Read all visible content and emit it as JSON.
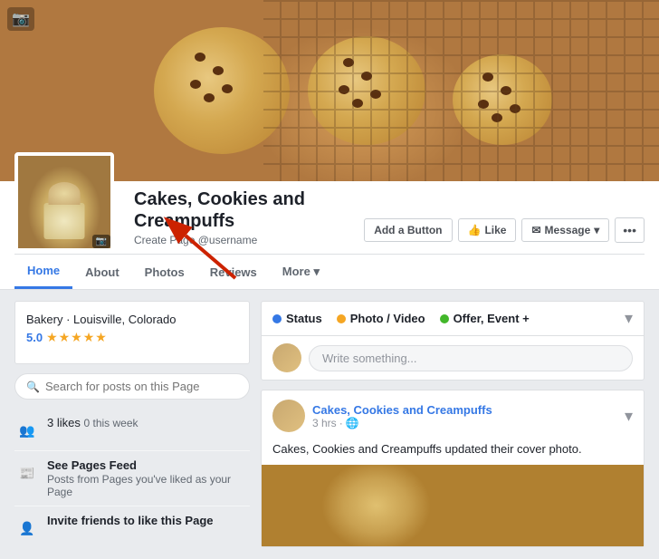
{
  "page": {
    "title": "Cakes, Cookies and Creampuffs",
    "username": "Create Page @username",
    "type": "Bakery · Louisville, Colorado",
    "rating": "5.0",
    "stars": "★★★★★"
  },
  "buttons": {
    "add_button": "Add a Button",
    "like": "Like",
    "message": "Message",
    "more_dots": "•••"
  },
  "nav": {
    "tabs": [
      "Home",
      "About",
      "Photos",
      "Reviews",
      "More ▾"
    ]
  },
  "search": {
    "placeholder": "Search for posts on this Page"
  },
  "sidebar": {
    "likes_count": "3 likes",
    "likes_sub": "0 this week",
    "pages_feed_title": "See Pages Feed",
    "pages_feed_sub": "Posts from Pages you've liked as your Page",
    "invite_title": "Invite friends to like this Page"
  },
  "post_box": {
    "status_label": "Status",
    "photo_video_label": "Photo / Video",
    "offer_event_label": "Offer, Event +",
    "placeholder": "Write something..."
  },
  "feed": {
    "post_name": "Cakes, Cookies and Creampuffs",
    "post_action": "updated their cover photo.",
    "post_time": "3 hrs",
    "privacy_icon": "🌐"
  },
  "colors": {
    "accent_blue": "#3578e5",
    "star_orange": "#f5a623",
    "green": "#42b72a",
    "bg": "#e9ebee",
    "text_dark": "#1d2129",
    "text_mid": "#606770",
    "text_light": "#90949c",
    "border": "#dddfe2"
  }
}
